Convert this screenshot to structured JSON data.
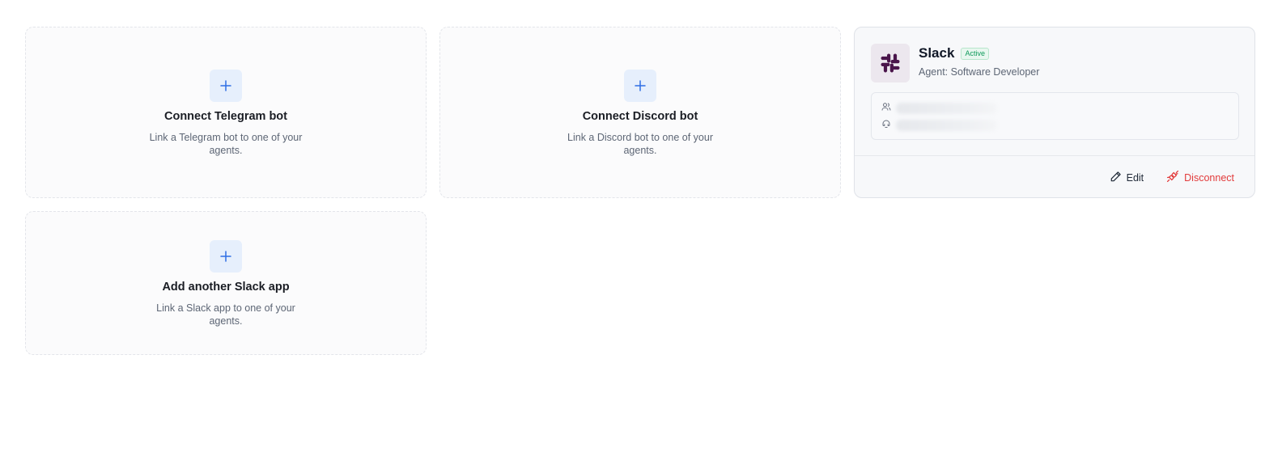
{
  "cards": {
    "telegram": {
      "title": "Connect Telegram bot",
      "description": "Link a Telegram bot to one of your agents.",
      "icon": "plus-icon"
    },
    "discord": {
      "title": "Connect Discord bot",
      "description": "Link a Discord bot to one of your agents.",
      "icon": "plus-icon"
    },
    "slack_add": {
      "title": "Add another Slack app",
      "description": "Link a Slack app to one of your agents.",
      "icon": "plus-icon"
    }
  },
  "slack": {
    "name": "Slack",
    "status": "Active",
    "agent": "Agent: Software Developer",
    "logo_icon": "slack-logo-icon",
    "details": [
      {
        "icon": "users-icon",
        "value": ""
      },
      {
        "icon": "workspace-icon",
        "value": ""
      }
    ],
    "actions": {
      "edit_label": "Edit",
      "disconnect_label": "Disconnect"
    }
  },
  "colors": {
    "accent": "#2f6fe4",
    "danger": "#e23b3b",
    "success": "#0f9a5b",
    "slack_aubergine": "#4a154b"
  }
}
